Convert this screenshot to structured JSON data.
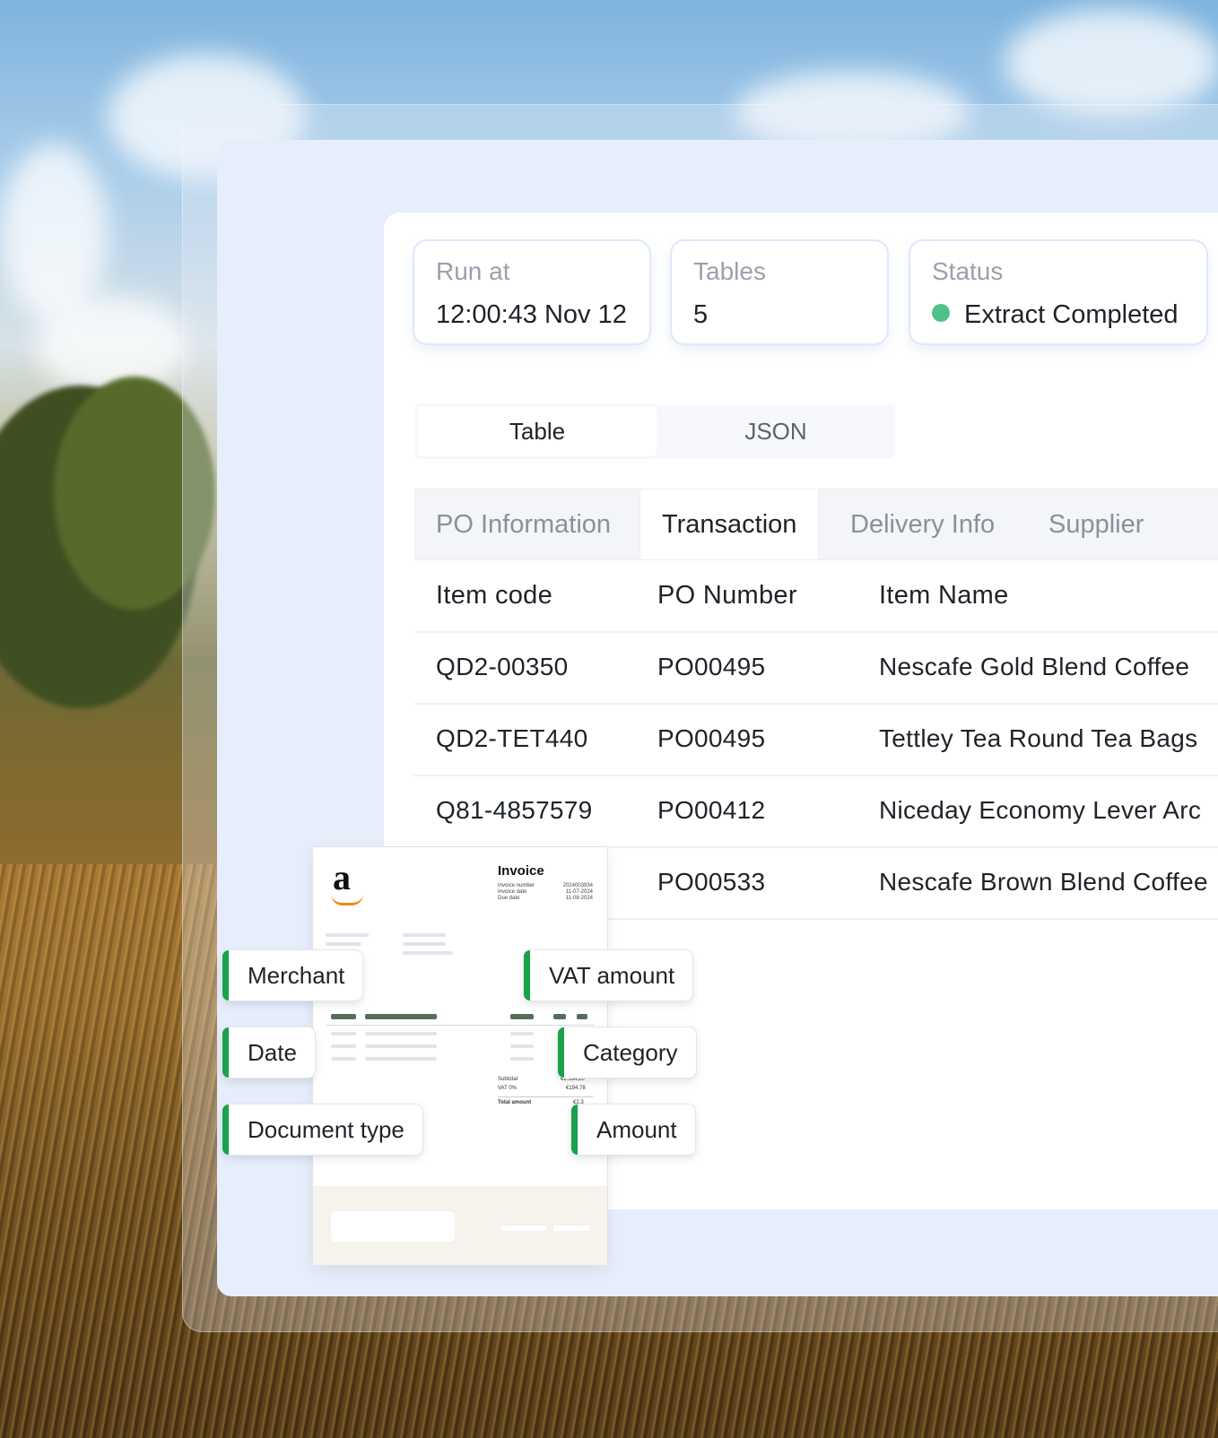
{
  "stats": {
    "run_at": {
      "label": "Run at",
      "value": "12:00:43 Nov 12"
    },
    "tables": {
      "label": "Tables",
      "value": "5"
    },
    "status": {
      "label": "Status",
      "value": "Extract Completed",
      "color": "#4fc28a"
    }
  },
  "view_toggle": {
    "options": [
      "Table",
      "JSON"
    ],
    "selected": "Table"
  },
  "table_tabs": {
    "items": [
      "PO Information",
      "Transaction",
      "Delivery Info",
      "Supplier"
    ],
    "selected": "Transaction"
  },
  "table": {
    "columns": [
      "Item code",
      "PO Number",
      "Item Name"
    ],
    "rows": [
      [
        "QD2-00350",
        "PO00495",
        "Nescafe Gold Blend Coffee"
      ],
      [
        "QD2-TET440",
        "PO00495",
        "Tettley Tea Round Tea Bags"
      ],
      [
        "Q81-4857579",
        "PO00412",
        "Niceday Economy Lever Arc"
      ],
      [
        "",
        "PO00533",
        "Nescafe Brown Blend Coffee"
      ]
    ]
  },
  "invoice": {
    "logo": "a",
    "title": "Invoice",
    "meta_labels": [
      "Invoice number",
      "Invoice date",
      "Due date"
    ],
    "meta_values": [
      "2024003934",
      "11-07-2024",
      "11-08-2024"
    ],
    "summary_labels": [
      "Subtotal",
      "VAT 0%",
      "Total amount"
    ],
    "summary_values": [
      "€2.164,20",
      "€194,78",
      "€2.3"
    ]
  },
  "fields": {
    "merchant": "Merchant",
    "vat_amount": "VAT amount",
    "date": "Date",
    "category": "Category",
    "document_type": "Document type",
    "amount": "Amount",
    "accent_color": "#1aa24a"
  }
}
